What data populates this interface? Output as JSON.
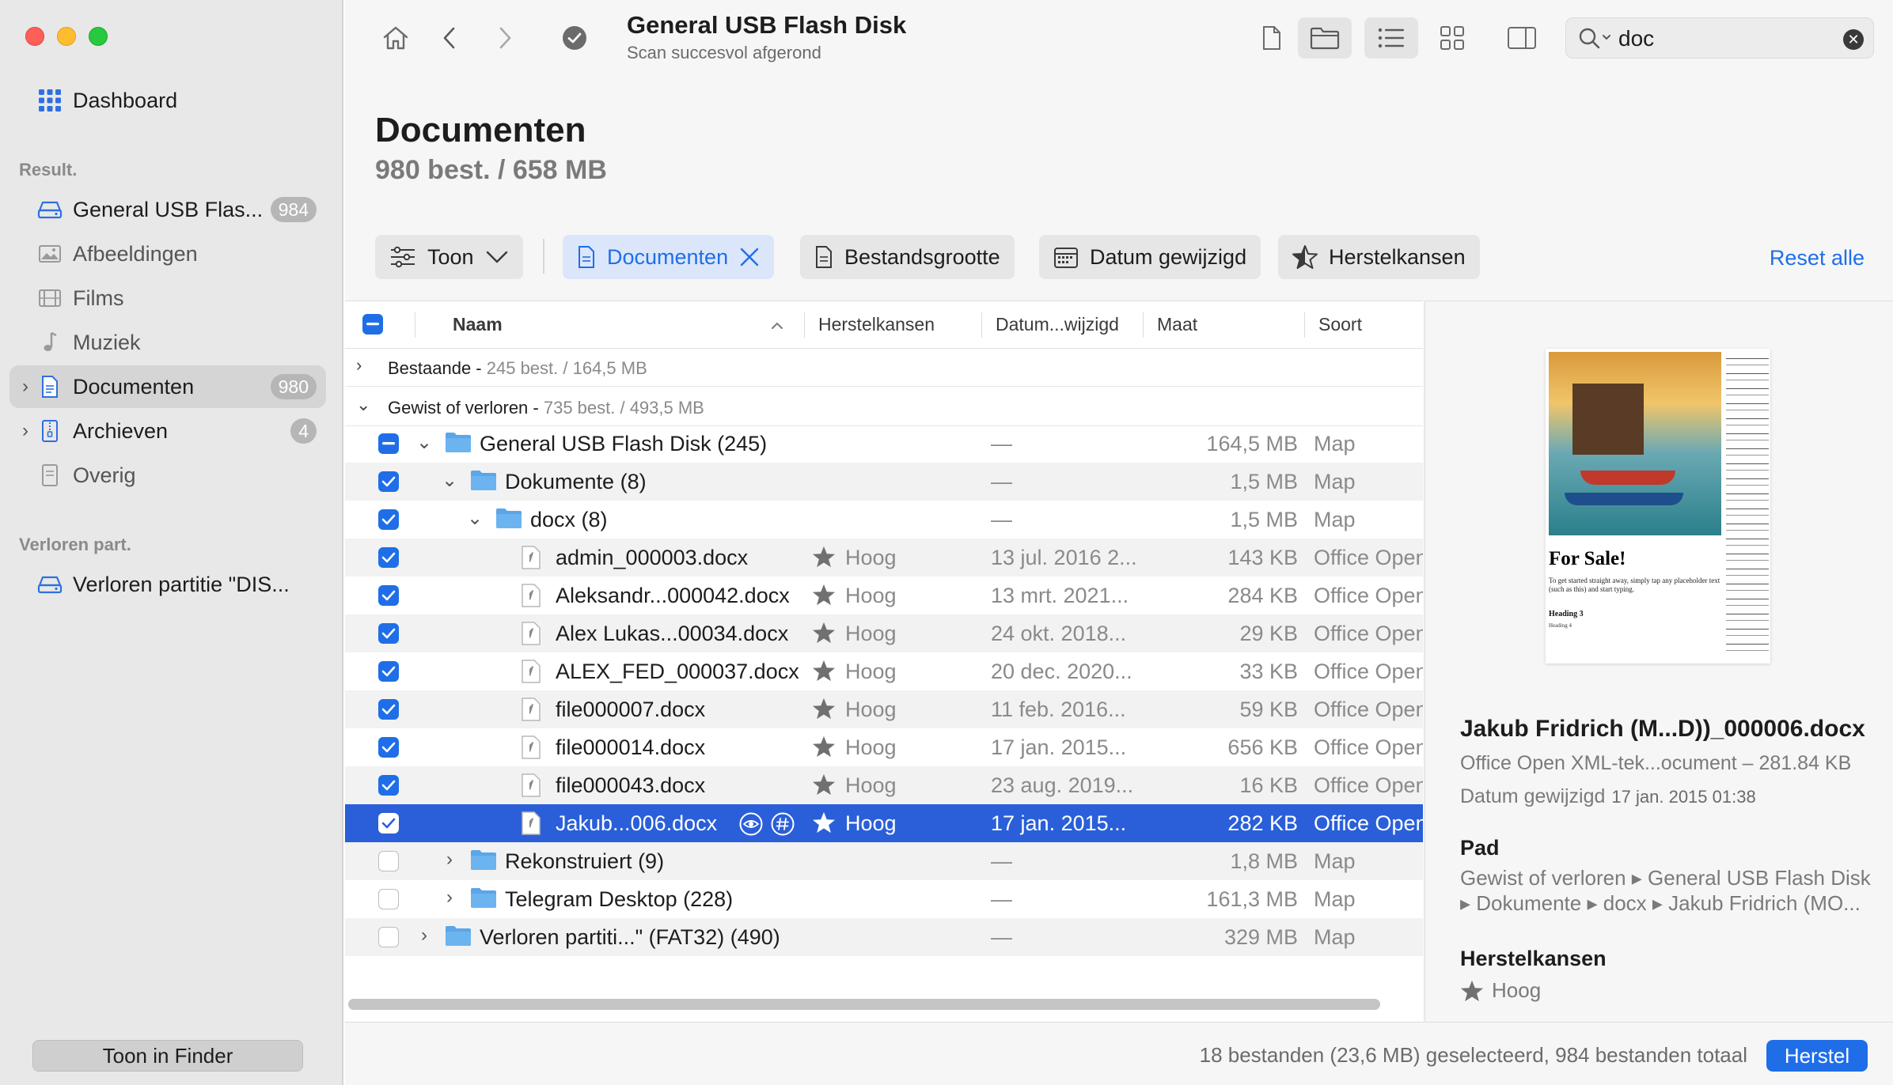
{
  "sidebar": {
    "dashboard": "Dashboard",
    "section_results": "Result.",
    "items": [
      {
        "label": "General USB Flas...",
        "count": "984"
      },
      {
        "label": "Afbeeldingen"
      },
      {
        "label": "Films"
      },
      {
        "label": "Muziek"
      },
      {
        "label": "Documenten",
        "count": "980"
      },
      {
        "label": "Archieven",
        "count": "4"
      },
      {
        "label": "Overig"
      }
    ],
    "section_lost": "Verloren part.",
    "lost_item": "Verloren partitie \"DIS...",
    "finder_button": "Toon in Finder"
  },
  "toolbar": {
    "title": "General USB Flash Disk",
    "subtitle": "Scan succesvol afgerond",
    "search_value": "doc"
  },
  "page": {
    "title": "Documenten",
    "count": "980 best. / 658 MB"
  },
  "filters": {
    "toon": "Toon",
    "documenten": "Documenten",
    "bestandsgrootte": "Bestandsgrootte",
    "datum": "Datum gewijzigd",
    "herstelkansen": "Herstelkansen",
    "reset": "Reset alle"
  },
  "table": {
    "headers": {
      "naam": "Naam",
      "herstelkansen": "Herstelkansen",
      "datum": "Datum...wijzigd",
      "maat": "Maat",
      "soort": "Soort"
    },
    "groups": [
      {
        "label": "Bestaande - ",
        "stats": "245 best. / 164,5 MB"
      },
      {
        "label": "Gewist of verloren - ",
        "stats": "735 best. / 493,5 MB"
      }
    ],
    "rows": [
      {
        "name": "General USB Flash Disk (245)",
        "date": "—",
        "size": "164,5 MB",
        "kind": "Map"
      },
      {
        "name": "Dokumente (8)",
        "date": "—",
        "size": "1,5 MB",
        "kind": "Map"
      },
      {
        "name": "docx (8)",
        "date": "—",
        "size": "1,5 MB",
        "kind": "Map"
      },
      {
        "name": "admin_000003.docx",
        "recovery": "Hoog",
        "date": "13 jul. 2016 2...",
        "size": "143 KB",
        "kind": "Office Open"
      },
      {
        "name": "Aleksandr...000042.docx",
        "recovery": "Hoog",
        "date": "13 mrt. 2021...",
        "size": "284 KB",
        "kind": "Office Open"
      },
      {
        "name": "Alex Lukas...00034.docx",
        "recovery": "Hoog",
        "date": "24 okt. 2018...",
        "size": "29 KB",
        "kind": "Office Open"
      },
      {
        "name": "ALEX_FED_000037.docx",
        "recovery": "Hoog",
        "date": "20 dec. 2020...",
        "size": "33 KB",
        "kind": "Office Open"
      },
      {
        "name": "file000007.docx",
        "recovery": "Hoog",
        "date": "11 feb. 2016...",
        "size": "59 KB",
        "kind": "Office Open"
      },
      {
        "name": "file000014.docx",
        "recovery": "Hoog",
        "date": "17 jan. 2015...",
        "size": "656 KB",
        "kind": "Office Open"
      },
      {
        "name": "file000043.docx",
        "recovery": "Hoog",
        "date": "23 aug. 2019...",
        "size": "16 KB",
        "kind": "Office Open"
      },
      {
        "name": "Jakub...006.docx",
        "recovery": "Hoog",
        "date": "17 jan. 2015...",
        "size": "282 KB",
        "kind": "Office Open"
      },
      {
        "name": "Rekonstruiert (9)",
        "date": "—",
        "size": "1,8 MB",
        "kind": "Map"
      },
      {
        "name": "Telegram Desktop (228)",
        "date": "—",
        "size": "161,3 MB",
        "kind": "Map"
      },
      {
        "name": "Verloren partiti...\" (FAT32) (490)",
        "date": "—",
        "size": "329 MB",
        "kind": "Map"
      }
    ]
  },
  "preview": {
    "doc_title": "For Sale!",
    "doc_body": "To get started straight away, simply tap any placeholder text (such as this) and start typing.",
    "doc_h3": "Heading 3",
    "doc_h4": "Heading 4",
    "name": "Jakub Fridrich (M...D))_000006.docx",
    "kind": "Office Open XML-tek...ocument – 281.84 KB",
    "date_label": "Datum gewijzigd",
    "date_value": "17 jan. 2015 01:38",
    "path_label": "Pad",
    "path_line1": "Gewist of verloren ▸ General USB Flash Disk",
    "path_line2": "▸ Dokumente ▸ docx ▸ Jakub Fridrich (MO...",
    "recovery_label": "Herstelkansen",
    "recovery_value": "Hoog"
  },
  "status": {
    "text": "18 bestanden (23,6 MB) geselecteerd, 984 bestanden totaal",
    "button": "Herstel"
  }
}
